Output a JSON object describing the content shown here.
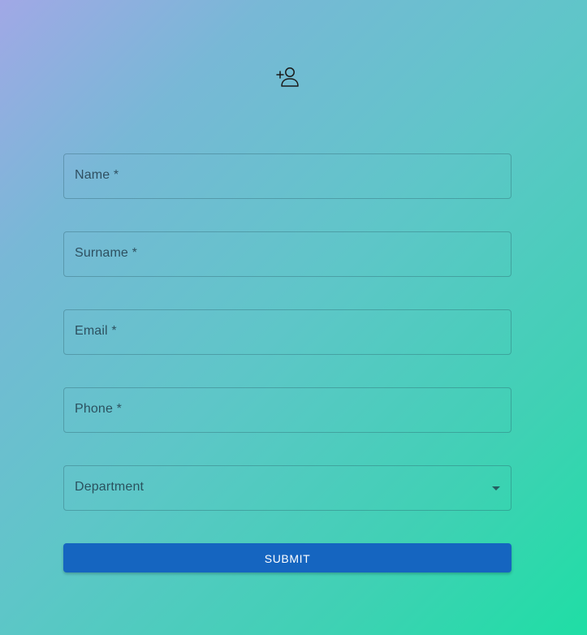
{
  "header": {
    "icon": "person-add-icon"
  },
  "form": {
    "fields": [
      {
        "label": "Name *",
        "value": ""
      },
      {
        "label": "Surname *",
        "value": ""
      },
      {
        "label": "Email *",
        "value": ""
      },
      {
        "label": "Phone *",
        "value": ""
      }
    ],
    "department": {
      "label": "Department",
      "selected": "",
      "icon": "chevron-down-icon"
    },
    "submit_label": "SUBMIT"
  },
  "colors": {
    "background_start": "#a1a8e6",
    "background_end": "#1fdea5",
    "submit_button": "#1565c0"
  }
}
